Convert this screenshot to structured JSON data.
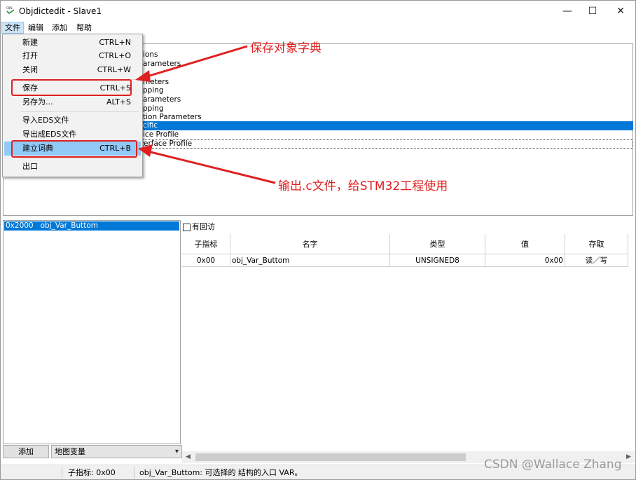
{
  "window": {
    "title": "Objdictedit - Slave1",
    "icon": "cbn-app-icon",
    "controls": {
      "minimize": "—",
      "maximize": "☐",
      "close": "✕"
    }
  },
  "menubar": [
    "文件",
    "编辑",
    "添加",
    "帮助"
  ],
  "file_menu": {
    "items": [
      {
        "label": "新建",
        "shortcut": "CTRL+N"
      },
      {
        "label": "打开",
        "shortcut": "CTRL+O"
      },
      {
        "label": "关闭",
        "shortcut": "CTRL+W"
      },
      {
        "label": "保存",
        "shortcut": "CTRL+S"
      },
      {
        "label": "另存为...",
        "shortcut": "ALT+S"
      },
      {
        "label": "导入EDS文件",
        "shortcut": ""
      },
      {
        "label": "导出成EDS文件",
        "shortcut": ""
      },
      {
        "label": "建立词典",
        "shortcut": "CTRL+B"
      },
      {
        "label": "出口",
        "shortcut": ""
      }
    ]
  },
  "tree": {
    "visible_fragments": [
      "ions",
      "arameters",
      "",
      "meters",
      "pping",
      "arameters",
      "pping",
      "tion Parameters",
      "cific",
      "ice Profile",
      "erface Profile"
    ],
    "selected_index": 8,
    "focused_index": 10
  },
  "index_list": {
    "rows": [
      "0x2000   obj_Var_Buttom"
    ]
  },
  "bottom_controls": {
    "add_button": "添加",
    "map_select": "地图变量"
  },
  "grid": {
    "checkbox_label": "有回访",
    "headers": [
      "子指标",
      "名字",
      "类型",
      "值",
      "存取"
    ],
    "rows": [
      {
        "subindex": "0x00",
        "name": "obj_Var_Buttom",
        "type": "UNSIGNED8",
        "value": "0x00",
        "access": "读／写"
      }
    ]
  },
  "statusbar": {
    "subindex": "子指标:   0x00",
    "description": "obj_Var_Buttom:   可选择的 结构的入口 VAR。"
  },
  "annotations": {
    "save_note": "保存对象字典",
    "build_note": "输出.c文件，给STM32工程使用",
    "color": "#e02020"
  },
  "watermark": "CSDN @Wallace Zhang"
}
